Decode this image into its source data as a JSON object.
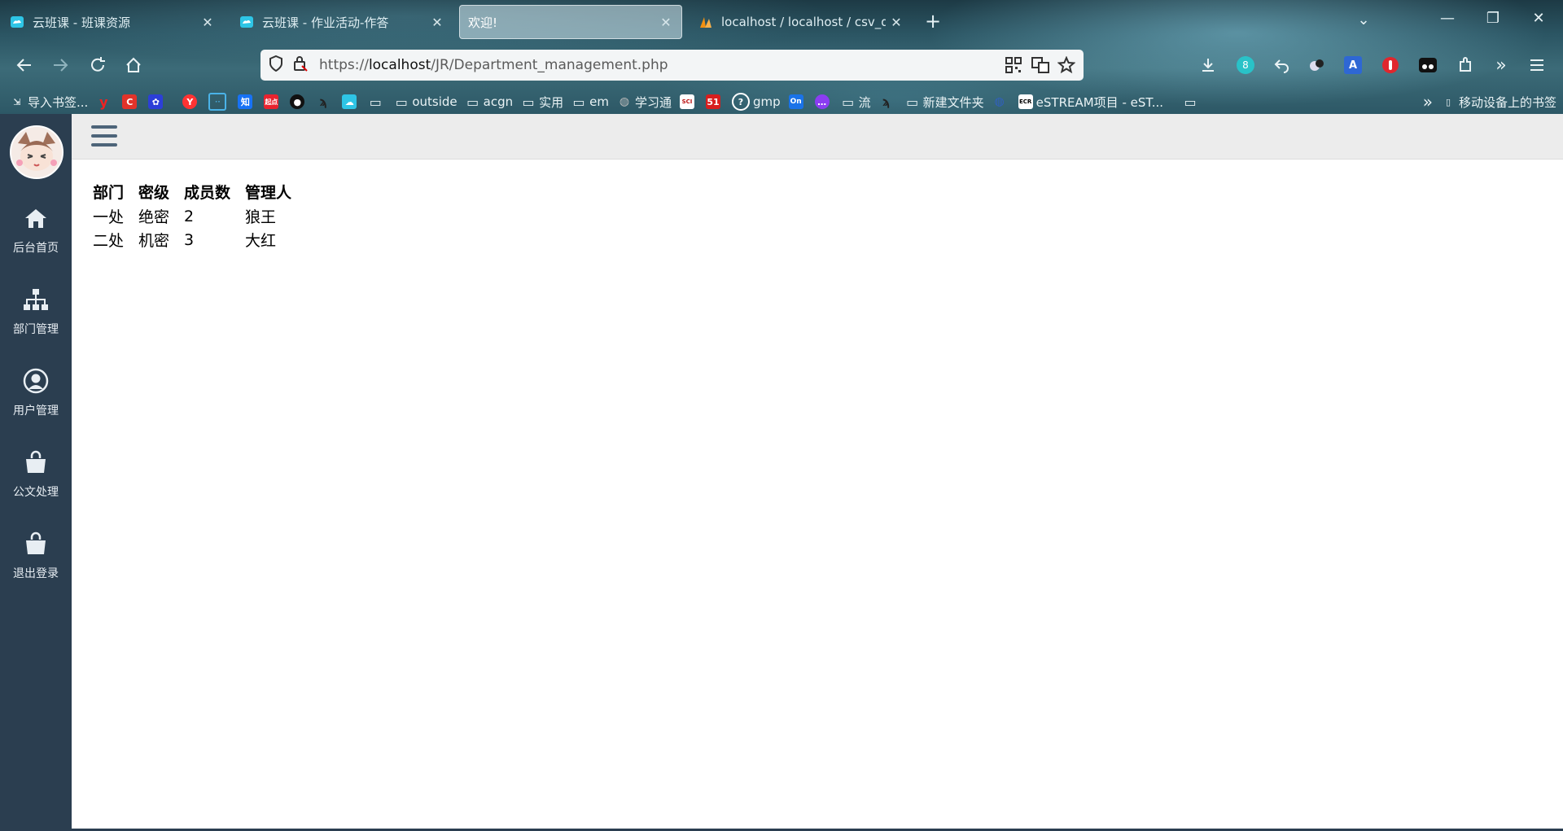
{
  "browser": {
    "tabs": [
      {
        "title": "云班课 - 班课资源",
        "active": false
      },
      {
        "title": "云班课 - 作业活动-作答",
        "active": false
      },
      {
        "title": "欢迎!",
        "active": true
      },
      {
        "title": "localhost / localhost / csv_db",
        "active": false
      }
    ],
    "url_prefix": "https://",
    "url_host": "localhost",
    "url_path": "/JR/Department_management.php",
    "extension_badge": "8",
    "bookmarks": [
      {
        "label": "导入书签...",
        "icon": "import-icon"
      },
      {
        "label": "",
        "icon": "youdao-icon"
      },
      {
        "label": "",
        "icon": "c-icon"
      },
      {
        "label": "",
        "icon": "baidu-icon"
      },
      {
        "label": "",
        "icon": "yandex-icon"
      },
      {
        "label": "",
        "icon": "bilibili-icon"
      },
      {
        "label": "",
        "icon": "zhihu-icon"
      },
      {
        "label": "",
        "icon": "qidian-icon"
      },
      {
        "label": "",
        "icon": "github-icon"
      },
      {
        "label": "",
        "icon": "script-icon"
      },
      {
        "label": "",
        "icon": "cloud-class-icon"
      },
      {
        "label": "",
        "icon": "folder-icon"
      },
      {
        "label": "outside",
        "icon": "folder-icon"
      },
      {
        "label": "acgn",
        "icon": "folder-icon"
      },
      {
        "label": "实用",
        "icon": "folder-icon"
      },
      {
        "label": "em",
        "icon": "folder-icon"
      },
      {
        "label": "学习通",
        "icon": "globe-icon"
      },
      {
        "label": "",
        "icon": "scihub-icon"
      },
      {
        "label": "",
        "icon": "51-icon"
      },
      {
        "label": "gmp",
        "icon": "help-icon"
      },
      {
        "label": "",
        "icon": "onenote-icon"
      },
      {
        "label": "",
        "icon": "chat-icon"
      },
      {
        "label": "流",
        "icon": "folder-icon"
      },
      {
        "label": "",
        "icon": "script-icon"
      },
      {
        "label": "新建文件夹",
        "icon": "folder-icon"
      },
      {
        "label": "",
        "icon": "globe-icon"
      },
      {
        "label": "eSTREAM项目 - eST...",
        "icon": "ecr-icon"
      },
      {
        "label": "",
        "icon": "folder-icon"
      }
    ],
    "mobile_bookmarks": "移动设备上的书签"
  },
  "sidebar": {
    "items": [
      {
        "label": "后台首页",
        "icon": "home-icon"
      },
      {
        "label": "部门管理",
        "icon": "sitemap-icon"
      },
      {
        "label": "用户管理",
        "icon": "user-circle-icon"
      },
      {
        "label": "公文处理",
        "icon": "shopping-bag-icon"
      },
      {
        "label": "退出登录",
        "icon": "shopping-bag-icon"
      }
    ]
  },
  "table": {
    "headers": [
      "部门",
      "密级",
      "成员数",
      "管理人"
    ],
    "rows": [
      [
        "一处",
        "绝密",
        "2",
        "狼王"
      ],
      [
        "二处",
        "机密",
        "3",
        "大红"
      ]
    ]
  }
}
